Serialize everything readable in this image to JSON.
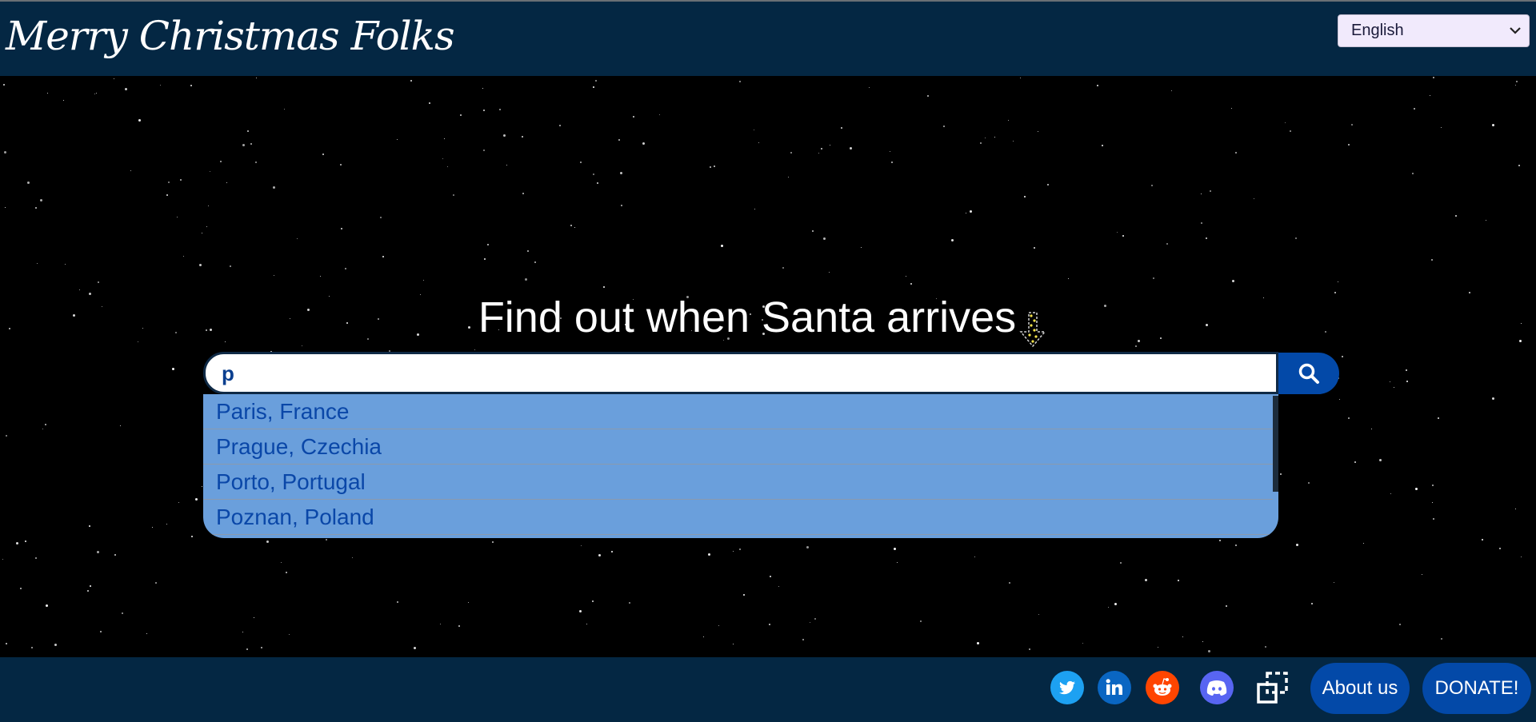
{
  "header": {
    "title": "Merry Christmas Folks",
    "language": {
      "selected": "English"
    }
  },
  "hero": {
    "headline": "Find out when Santa arrives"
  },
  "search": {
    "value": "p",
    "suggestions": [
      {
        "label": "Paris, France"
      },
      {
        "label": "Prague, Czechia"
      },
      {
        "label": "Porto, Portugal"
      },
      {
        "label": "Poznan, Poland"
      }
    ]
  },
  "footer": {
    "icons": [
      "twitter-icon",
      "linkedin-icon",
      "reddit-icon",
      "discord-icon",
      "share-icon"
    ],
    "about_label": "About us",
    "donate_label": "DONATE!"
  },
  "colors": {
    "header_bg": "#042743",
    "accent": "#0349a8",
    "suggestion_bg": "#6a9fdc",
    "suggestion_text": "#0a47a8"
  }
}
